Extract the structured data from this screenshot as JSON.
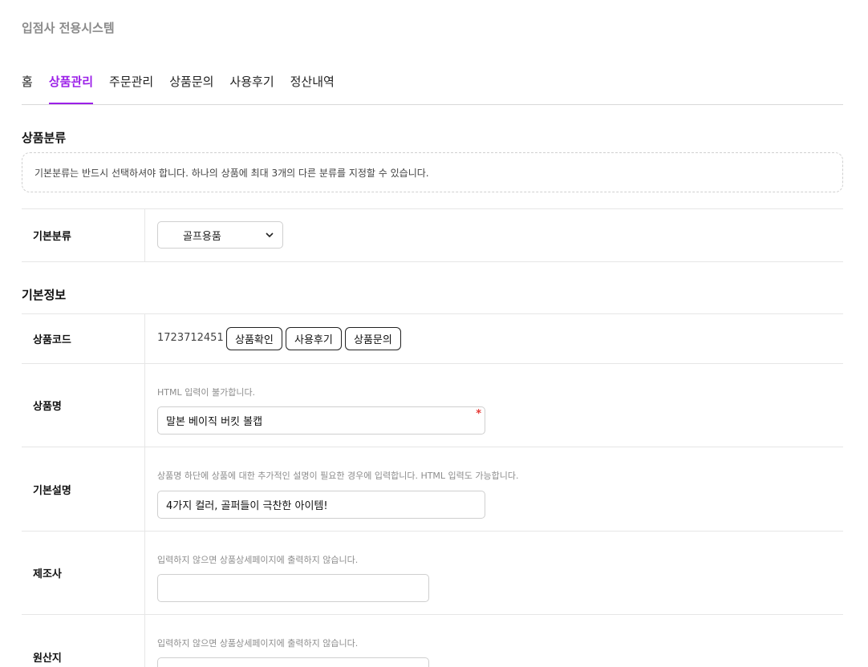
{
  "app": {
    "title": "입점사 전용시스템"
  },
  "tabs": [
    {
      "label": "홈",
      "active": false
    },
    {
      "label": "상품관리",
      "active": true
    },
    {
      "label": "주문관리",
      "active": false
    },
    {
      "label": "상품문의",
      "active": false
    },
    {
      "label": "사용후기",
      "active": false
    },
    {
      "label": "정산내역",
      "active": false
    }
  ],
  "category": {
    "title": "상품분류",
    "notice": "기본분류는 반드시 선택하셔야 합니다. 하나의 상품에 최대 3개의 다른 분류를 지정할 수 있습니다.",
    "base_label": "기본분류",
    "base_value": "골프용품"
  },
  "basic": {
    "title": "기본정보",
    "code_label": "상품코드",
    "code_value": "1723712451",
    "buttons": [
      "상품확인",
      "사용후기",
      "상품문의"
    ],
    "name_label": "상품명",
    "name_hint": "HTML 입력이 불가합니다.",
    "name_value": "말본 베이직 버킷 볼캡",
    "required_mark": "*",
    "desc_label": "기본설명",
    "desc_hint": "상품명 하단에 상품에 대한 추가적인 설명이 필요한 경우에 입력합니다. HTML 입력도 가능합니다.",
    "desc_value": "4가지 컬러, 골퍼들이 극찬한 아이템!",
    "maker_label": "제조사",
    "maker_hint": "입력하지 않으면 상품상세페이지에 출력하지 않습니다.",
    "maker_value": "",
    "origin_label": "원산지",
    "origin_hint": "입력하지 않으면 상품상세페이지에 출력하지 않습니다."
  },
  "colors": {
    "accent": "#9b1fe8",
    "required": "#e53935"
  }
}
